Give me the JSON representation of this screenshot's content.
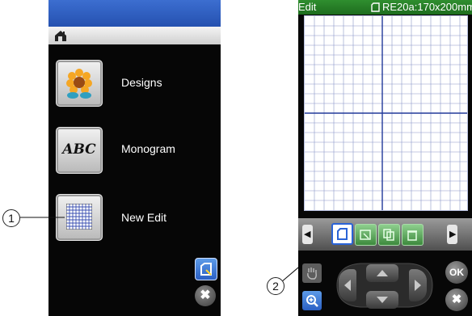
{
  "left_screen": {
    "menu": [
      {
        "label": "Designs",
        "icon": "sunflower-design-icon"
      },
      {
        "label": "Monogram",
        "icon": "abc-monogram-icon",
        "icon_text": "ABC"
      },
      {
        "label": "New Edit",
        "icon": "grid-edit-icon"
      }
    ],
    "bottom_buttons": [
      "hoop-select-icon",
      "close-icon"
    ],
    "close_glyph": "✖"
  },
  "right_screen": {
    "title": "Edit",
    "hoop": "RE20a:170x200mm",
    "tools": [
      "hoop-select-icon",
      "open-file-icon",
      "copy-icon",
      "delete-icon"
    ],
    "ok_label": "OK",
    "close_glyph": "✖",
    "arrows": {
      "left": "◀",
      "right": "▶"
    }
  },
  "callouts": {
    "one": "1",
    "two": "2"
  },
  "colors": {
    "blue_bar": "#2d5ec3",
    "green_bar": "#237a23",
    "grid_line": "#3355aa",
    "tool_green": "#4f9e4f"
  }
}
